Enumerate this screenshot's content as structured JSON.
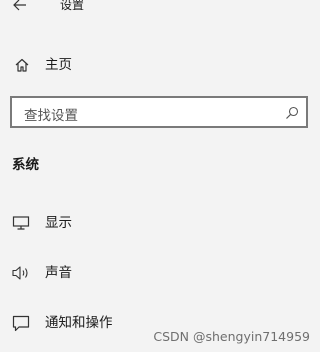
{
  "window": {
    "title": "设置",
    "back_icon": "back-arrow-icon"
  },
  "home": {
    "label": "主页",
    "icon": "home-icon"
  },
  "search": {
    "placeholder": "查找设置",
    "icon": "search-icon"
  },
  "section": {
    "title": "系统"
  },
  "nav_items": [
    {
      "label": "显示",
      "icon": "monitor-icon"
    },
    {
      "label": "声音",
      "icon": "speaker-icon"
    },
    {
      "label": "通知和操作",
      "icon": "notification-icon"
    }
  ],
  "watermark": "CSDN @shengyin714959",
  "colors": {
    "background": "#f3f3f3",
    "search_border": "#7a7a7a",
    "text": "#1a1a1a"
  }
}
